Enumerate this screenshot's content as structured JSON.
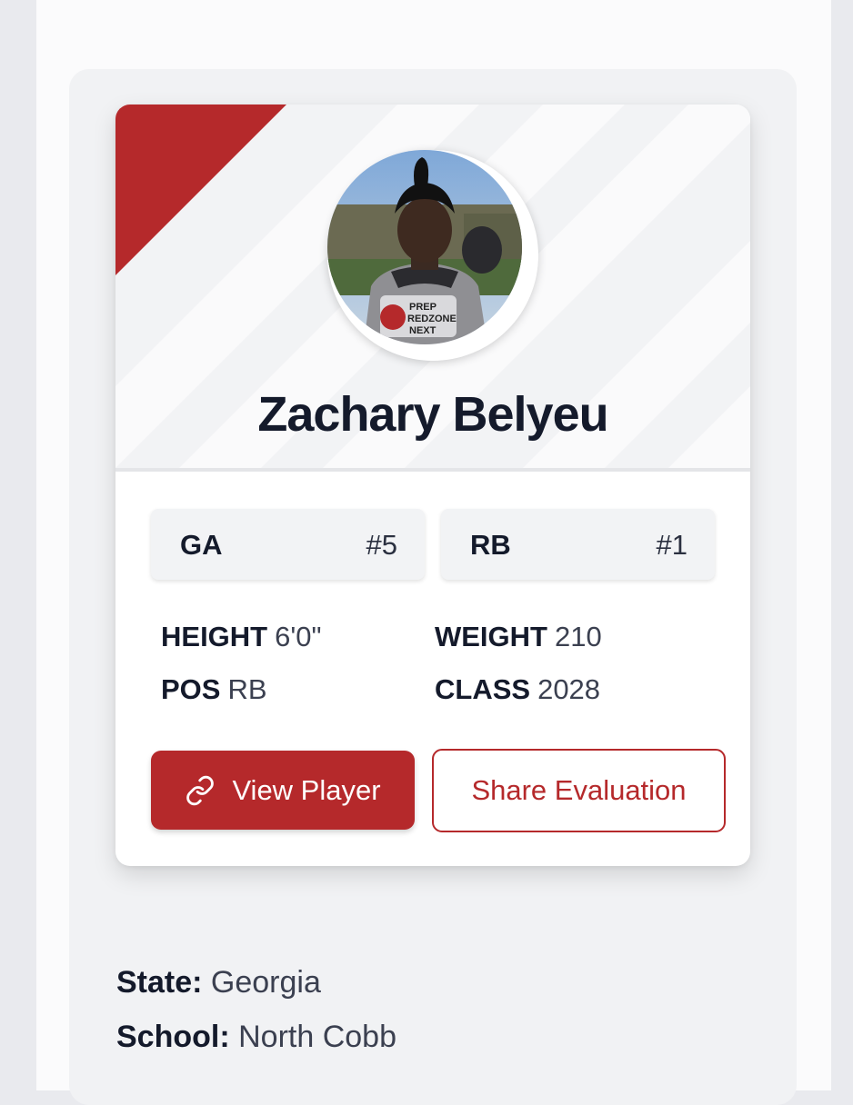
{
  "player": {
    "name": "Zachary Belyeu",
    "photo_caption": "PREP REDZONE NEXT"
  },
  "rankings": [
    {
      "label": "GA",
      "rank": "#5"
    },
    {
      "label": "RB",
      "rank": "#1"
    }
  ],
  "stats": {
    "height_label": "HEIGHT",
    "height": "6'0\"",
    "weight_label": "WEIGHT",
    "weight": "210",
    "pos_label": "POS",
    "pos": "RB",
    "class_label": "CLASS",
    "class": "2028"
  },
  "actions": {
    "view_label": "View Player",
    "view_icon": "link-icon",
    "share_label": "Share Evaluation"
  },
  "details": {
    "state_label": "State:",
    "state": "Georgia",
    "school_label": "School:",
    "school": "North Cobb"
  },
  "colors": {
    "accent": "#b5292b",
    "text": "#141a2b",
    "panel": "#f1f2f4"
  }
}
